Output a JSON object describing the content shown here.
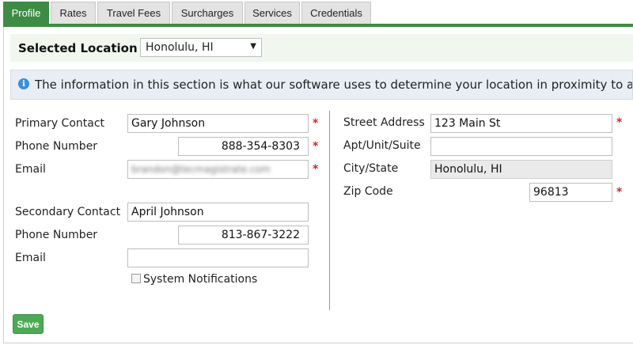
{
  "tabs": [
    {
      "label": "Profile",
      "active": true
    },
    {
      "label": "Rates",
      "active": false
    },
    {
      "label": "Travel Fees",
      "active": false
    },
    {
      "label": "Surcharges",
      "active": false
    },
    {
      "label": "Services",
      "active": false
    },
    {
      "label": "Credentials",
      "active": false
    }
  ],
  "location": {
    "label": "Selected Location",
    "selected": "Honolulu, HI"
  },
  "info": {
    "icon": "info-icon",
    "text": "The information in this section is what our software uses to determine your location in proximity to available"
  },
  "primary": {
    "contact_label": "Primary Contact",
    "contact_value": "Gary Johnson",
    "phone_label": "Phone Number",
    "phone_value": "888-354-8303",
    "email_label": "Email",
    "email_value": "brandon@tecmagistrate.com"
  },
  "secondary": {
    "contact_label": "Secondary Contact",
    "contact_value": "April Johnson",
    "phone_label": "Phone Number",
    "phone_value": "813-867-3222",
    "email_label": "Email",
    "email_value": ""
  },
  "notifications": {
    "label": "System Notifications",
    "checked": false
  },
  "address": {
    "street_label": "Street Address",
    "street_value": "123 Main St",
    "apt_label": "Apt/Unit/Suite",
    "apt_value": "",
    "city_label": "City/State",
    "city_value": "Honolulu, HI",
    "zip_label": "Zip Code",
    "zip_value": "96813"
  },
  "required_mark": "*",
  "actions": {
    "save_label": "Save"
  },
  "colors": {
    "accent": "#3d8b45",
    "required": "#dd2222",
    "save": "#4caa54"
  }
}
